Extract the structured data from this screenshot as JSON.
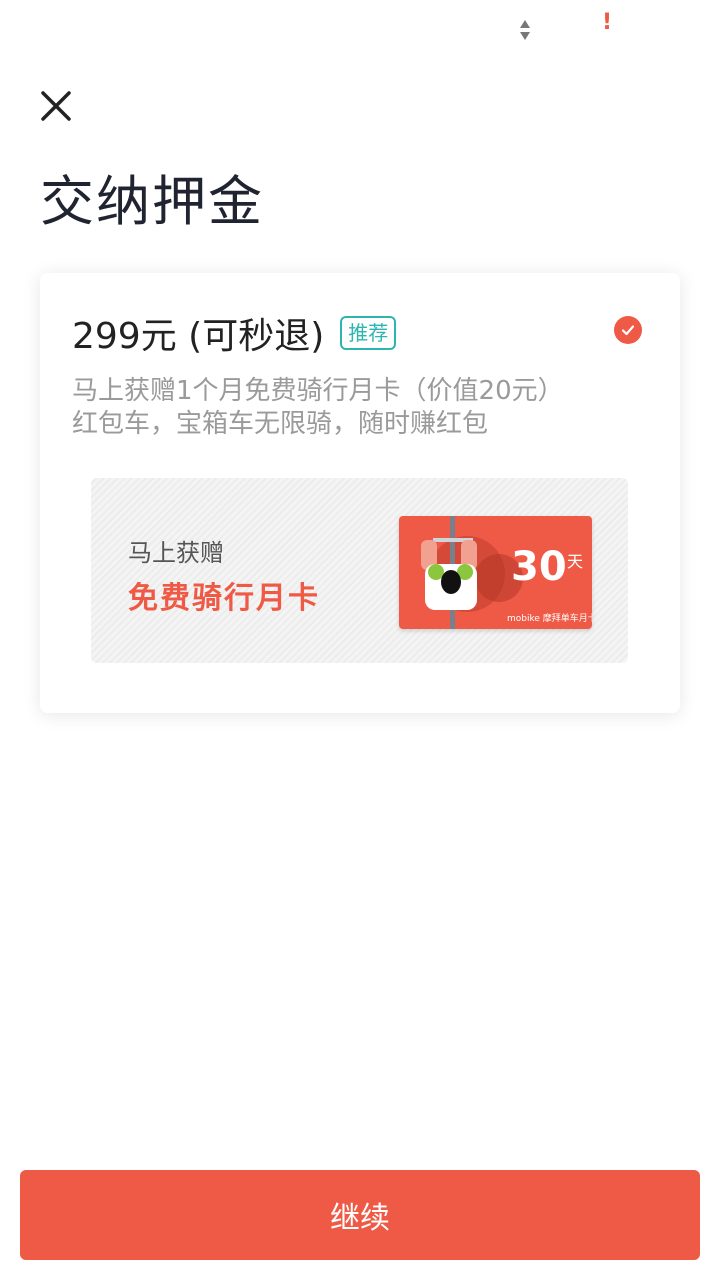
{
  "status_bar": {
    "data_icon": "data-arrows-icon",
    "alert": "!"
  },
  "header": {
    "close_icon": "close-icon",
    "title": "交纳押金"
  },
  "deposit_option": {
    "price_label": "299元 (可秒退)",
    "badge": "推荐",
    "selected": true,
    "description_line1": "马上获赠1个月免费骑行月卡（价值20元）",
    "description_line2": "红包车，宝箱车无限骑，随时赚红包",
    "promo": {
      "subtitle": "马上获赠",
      "title": "免费骑行月卡",
      "card_days": "30",
      "card_unit": "天",
      "card_brand": "mobike 摩拜单车月卡"
    }
  },
  "footer": {
    "continue_label": "继续"
  },
  "colors": {
    "accent": "#ef5a46",
    "badge": "#2fb5b0"
  }
}
